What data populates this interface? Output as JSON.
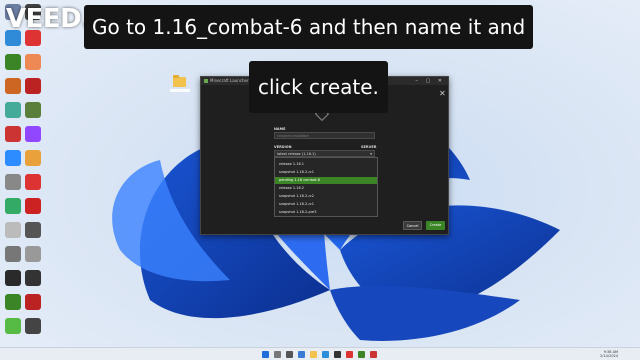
{
  "watermark": "VEED.IO",
  "captions": {
    "line1": "Go to 1.16_combat-6 and then name it and",
    "line2": "click create."
  },
  "launcher": {
    "window_title": "Minecraft Launcher",
    "window_controls": "–  ▢  ✕",
    "close_glyph": "✕",
    "name_label": "NAME",
    "name_placeholder": "unnamed installation",
    "version_label": "VERSION",
    "server_label": "SERVER",
    "version_selected": "latest release (1.16.1)",
    "versions": [
      "release 1.16.1",
      "snapshot 1.16.2-rc1",
      "pending 1.16 combat-6",
      "release 1.16.2",
      "snapshot 1.16.2-rc2",
      "snapshot 1.16.2-rc1",
      "snapshot 1.16.2-pre3"
    ],
    "selected_index": 2,
    "cancel_label": "Cancel",
    "create_label": "Create"
  },
  "tray": {
    "time": "9:38 AM",
    "date": "2/14/2024"
  },
  "colors": {
    "accent_green": "#3c8527",
    "launcher_bg": "#1f1f1f",
    "caption_bg": "#141414"
  }
}
